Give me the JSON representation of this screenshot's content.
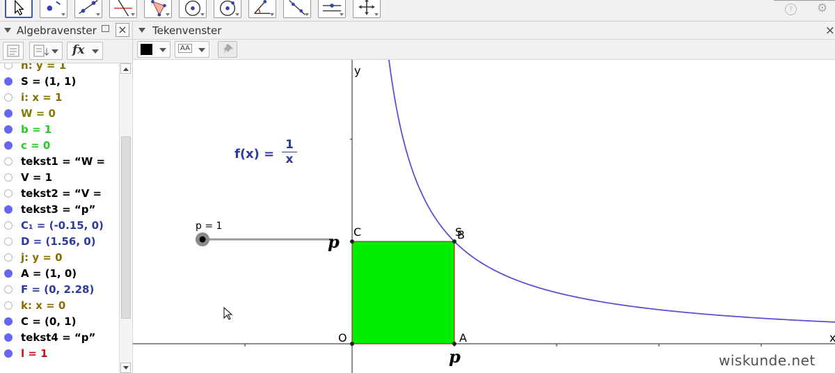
{
  "app": {
    "colors": {
      "accent": "#3b5bbf",
      "curve": "#5b4fd6",
      "square_fill": "#00ee00",
      "square_edge": "#b52a1a"
    }
  },
  "toolbar": {
    "tools": [
      {
        "icon": "move-arrow-icon",
        "active": true
      },
      {
        "icon": "point-icon"
      },
      {
        "icon": "line-icon"
      },
      {
        "icon": "perpendicular-line-icon"
      },
      {
        "icon": "polygon-icon"
      },
      {
        "icon": "circle-center-point-icon"
      },
      {
        "icon": "circle-through-point-icon"
      },
      {
        "icon": "angle-icon"
      },
      {
        "icon": "reflect-icon"
      },
      {
        "icon": "slider-icon"
      },
      {
        "icon": "move-graphics-view-icon"
      }
    ],
    "help_symbol": "?",
    "gear_symbol": "⚙"
  },
  "algebra": {
    "title": "Algebravenster",
    "close_symbol": "×",
    "fx_label": "fx",
    "items": [
      {
        "text": "h: y = 1",
        "color": "#8a6d00",
        "shown": false
      },
      {
        "text": "S = (1, 1)",
        "color": "#000000",
        "shown": true
      },
      {
        "text": "i: x = 1",
        "color": "#8a6d00",
        "shown": false
      },
      {
        "text": "W = 0",
        "color": "#7d7d00",
        "shown": true
      },
      {
        "text": "b = 1",
        "color": "#22cc22",
        "shown": true
      },
      {
        "text": "c = 0",
        "color": "#22cc22",
        "shown": true
      },
      {
        "text": "tekst1 = “W =",
        "color": "#000000",
        "shown": false
      },
      {
        "text": "V = 1",
        "color": "#000000",
        "shown": false
      },
      {
        "text": "tekst2 = “V =",
        "color": "#000000",
        "shown": false
      },
      {
        "text": "tekst3 = “p”",
        "color": "#000000",
        "shown": true
      },
      {
        "text": "C₁ = (-0.15, 0)",
        "color": "#2c3a9c",
        "shown": false
      },
      {
        "text": "D = (1.56, 0)",
        "color": "#2c3a9c",
        "shown": false
      },
      {
        "text": "j: y = 0",
        "color": "#8a6d00",
        "shown": false
      },
      {
        "text": "A = (1, 0)",
        "color": "#000000",
        "shown": true
      },
      {
        "text": "F = (0, 2.28)",
        "color": "#2c3a9c",
        "shown": false
      },
      {
        "text": "k: x = 0",
        "color": "#8a6d00",
        "shown": false
      },
      {
        "text": "C = (0, 1)",
        "color": "#000000",
        "shown": true
      },
      {
        "text": "tekst4 = “p”",
        "color": "#000000",
        "shown": true
      },
      {
        "text": "l = 1",
        "color": "#cc1111",
        "shown": true
      }
    ]
  },
  "graphics": {
    "title": "Tekenvenster",
    "close_symbol": "×",
    "style_bar": {
      "color": "#000000",
      "text_style": "AA"
    },
    "axes": {
      "x_label": "x",
      "y_label": "y",
      "origin_label": "O"
    },
    "points": {
      "A": "A",
      "B": "B",
      "C": "C",
      "S": "S"
    },
    "slider": {
      "label": "p = 1",
      "value": 1
    },
    "function_label": {
      "lhs": "f(x) =",
      "numerator": "1",
      "denominator": "x"
    },
    "p_text": "p",
    "watermark": "wiskunde.net"
  }
}
